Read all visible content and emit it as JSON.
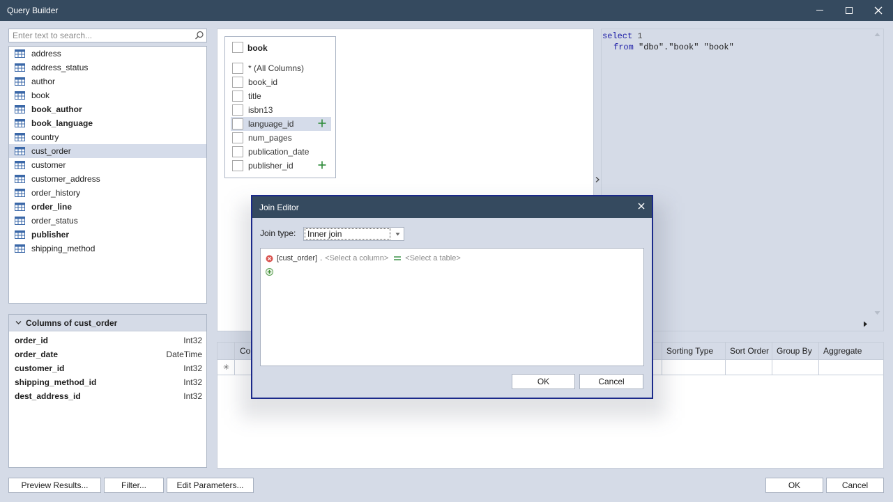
{
  "window": {
    "title": "Query Builder"
  },
  "search": {
    "placeholder": "Enter text to search..."
  },
  "tables": [
    {
      "name": "address",
      "bold": false
    },
    {
      "name": "address_status",
      "bold": false
    },
    {
      "name": "author",
      "bold": false
    },
    {
      "name": "book",
      "bold": false
    },
    {
      "name": "book_author",
      "bold": true
    },
    {
      "name": "book_language",
      "bold": true
    },
    {
      "name": "country",
      "bold": false
    },
    {
      "name": "cust_order",
      "bold": false,
      "selected": true
    },
    {
      "name": "customer",
      "bold": false
    },
    {
      "name": "customer_address",
      "bold": false
    },
    {
      "name": "order_history",
      "bold": false
    },
    {
      "name": "order_line",
      "bold": true
    },
    {
      "name": "order_status",
      "bold": false
    },
    {
      "name": "publisher",
      "bold": true
    },
    {
      "name": "shipping_method",
      "bold": false
    }
  ],
  "columns_panel": {
    "title": "Columns of cust_order",
    "columns": [
      {
        "name": "order_id",
        "type": "Int32"
      },
      {
        "name": "order_date",
        "type": "DateTime"
      },
      {
        "name": "customer_id",
        "type": "Int32"
      },
      {
        "name": "shipping_method_id",
        "type": "Int32"
      },
      {
        "name": "dest_address_id",
        "type": "Int32"
      }
    ]
  },
  "design_table": {
    "name": "book",
    "fields": [
      {
        "label": "* (All Columns)"
      },
      {
        "label": "book_id"
      },
      {
        "label": "title"
      },
      {
        "label": "isbn13"
      },
      {
        "label": "language_id",
        "fk": true,
        "selected": true
      },
      {
        "label": "num_pages"
      },
      {
        "label": "publication_date"
      },
      {
        "label": "publisher_id",
        "fk": true
      }
    ]
  },
  "sql": {
    "kw_select": "select",
    "select_value": "1",
    "kw_from": "from",
    "from_rest": "\"dbo\".\"book\" \"book\""
  },
  "grid": {
    "col_first": "Co",
    "headers": [
      "Sorting Type",
      "Sort Order",
      "Group By",
      "Aggregate"
    ]
  },
  "join_editor": {
    "title": "Join Editor",
    "join_type_label": "Join type:",
    "join_type_value": "Inner join",
    "condition": {
      "left_table": "[cust_order]",
      "dot": ".",
      "column_placeholder": "<Select a column>",
      "right_placeholder": "<Select a table>"
    },
    "ok_label": "OK",
    "cancel_label": "Cancel"
  },
  "footer": {
    "preview_label": "Preview Results...",
    "filter_label": "Filter...",
    "params_label": "Edit Parameters...",
    "ok_label": "OK",
    "cancel_label": "Cancel"
  },
  "colors": {
    "titlebar": "#354a5f",
    "background": "#d5dbe7",
    "selection": "#d5dcea",
    "accent_green": "#2e8b3a",
    "error_red": "#d9534f",
    "dialog_border": "#1b2a8a"
  }
}
